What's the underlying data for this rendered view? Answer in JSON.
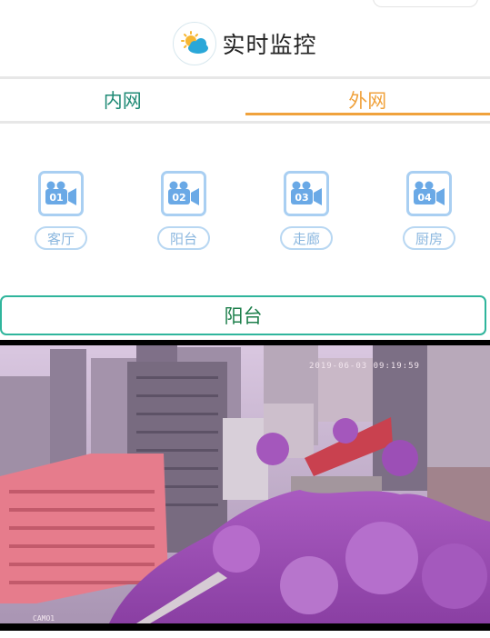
{
  "header": {
    "title": "实时监控",
    "logo_icon": "sun-cloud-icon"
  },
  "tabs": [
    {
      "label": "内网",
      "active": false
    },
    {
      "label": "外网",
      "active": true
    }
  ],
  "cameras": [
    {
      "number": "01",
      "label": "客厅"
    },
    {
      "number": "02",
      "label": "阳台"
    },
    {
      "number": "03",
      "label": "走廊"
    },
    {
      "number": "04",
      "label": "厨房"
    }
  ],
  "current_camera": "阳台",
  "video": {
    "timestamp": "2019-06-03 09:19:59",
    "camera_name": "CAMO1"
  },
  "colors": {
    "inner_tab": "#1f8a75",
    "outer_tab": "#f0a23c",
    "camera_icon": "#a9cff2",
    "current_border": "#2fb59c",
    "current_text": "#1d7f4b"
  }
}
